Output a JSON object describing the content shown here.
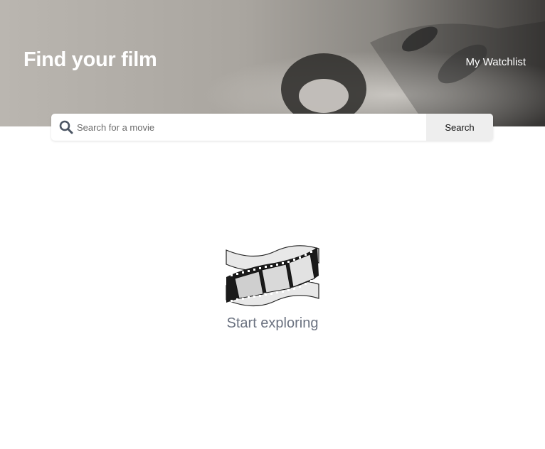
{
  "header": {
    "title": "Find your film",
    "watchlist_label": "My Watchlist"
  },
  "search": {
    "placeholder": "Search for a movie",
    "value": "",
    "button_label": "Search",
    "icon": "search-icon"
  },
  "empty_state": {
    "icon": "film-reel-icon",
    "label": "Start exploring"
  },
  "colors": {
    "header_text": "#ffffff",
    "search_button_bg": "#eeeeee",
    "empty_label": "#6b7280",
    "search_icon": "#4b5563"
  }
}
